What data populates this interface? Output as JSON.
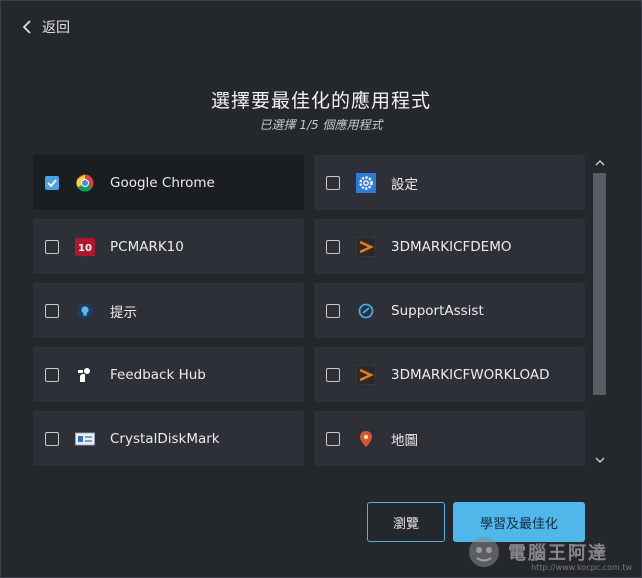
{
  "nav": {
    "back_label": "返回"
  },
  "header": {
    "title": "選擇要最佳化的應用程式",
    "subtitle": "已選擇 1/5 個應用程式"
  },
  "apps": [
    {
      "name": "Google Chrome",
      "checked": true,
      "icon": "chrome-icon"
    },
    {
      "name": "設定",
      "checked": false,
      "icon": "settings-gear-icon"
    },
    {
      "name": "PCMARK10",
      "checked": false,
      "icon": "pcmark10-icon"
    },
    {
      "name": "3DMARKICFDEMO",
      "checked": false,
      "icon": "3dmark-icon"
    },
    {
      "name": "提示",
      "checked": false,
      "icon": "tips-lightbulb-icon"
    },
    {
      "name": "SupportAssist",
      "checked": false,
      "icon": "supportassist-icon"
    },
    {
      "name": "Feedback Hub",
      "checked": false,
      "icon": "feedback-hub-icon"
    },
    {
      "name": "3DMARKICFWORKLOAD",
      "checked": false,
      "icon": "3dmark-icon"
    },
    {
      "name": "CrystalDiskMark",
      "checked": false,
      "icon": "crystaldiskmark-icon"
    },
    {
      "name": "地圖",
      "checked": false,
      "icon": "maps-pin-icon"
    }
  ],
  "buttons": {
    "browse": "瀏覽",
    "learn_optimize": "學習及最佳化"
  },
  "watermark": {
    "text": "電腦王阿達",
    "url": "http://www.kocpc.com.tw"
  },
  "colors": {
    "accent": "#4fb7ea",
    "background": "#24272c",
    "tile": "#2d3137"
  }
}
